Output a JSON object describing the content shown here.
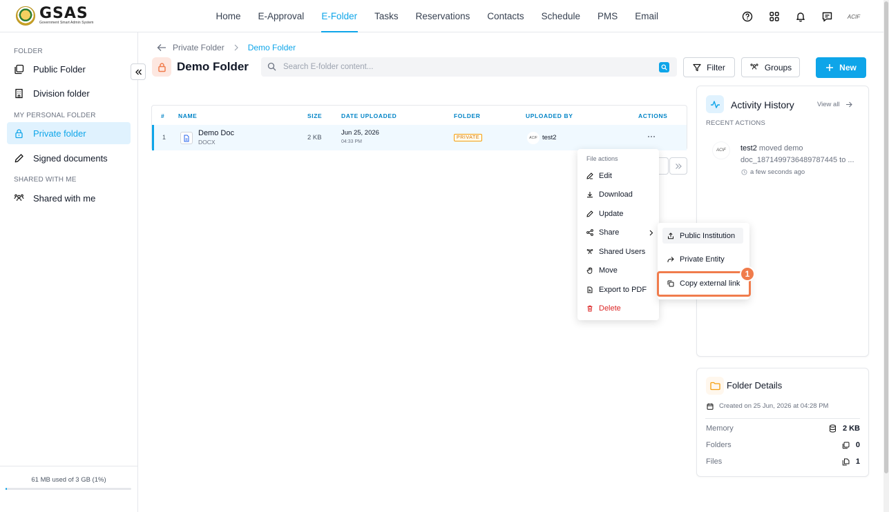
{
  "app": {
    "logo_title": "GSAS",
    "logo_subtitle": "Government Smart Admin System"
  },
  "nav": {
    "items": [
      "Home",
      "E-Approval",
      "E-Folder",
      "Tasks",
      "Reservations",
      "Contacts",
      "Schedule",
      "PMS",
      "Email"
    ],
    "active": "E-Folder"
  },
  "top_icons": [
    "help-icon",
    "apps-grid-icon",
    "bell-icon",
    "chat-icon"
  ],
  "user_avatar": "ACIF",
  "sidebar": {
    "section_folder": "FOLDER",
    "public_folder": "Public Folder",
    "division_folder": "Division folder",
    "section_personal": "MY PERSONAL FOLDER",
    "private_folder": "Private folder",
    "signed_documents": "Signed documents",
    "section_shared": "SHARED WITH ME",
    "shared_with_me": "Shared with me",
    "storage_text": "61 MB used of 3 GB (1%)",
    "storage_percent": 1
  },
  "breadcrumb": {
    "parent": "Private Folder",
    "current": "Demo Folder"
  },
  "header": {
    "title": "Demo Folder",
    "search_placeholder": "Search E-folder content...",
    "filter_label": "Filter",
    "groups_label": "Groups",
    "new_label": "New"
  },
  "table": {
    "columns": [
      "#",
      "NAME",
      "SIZE",
      "DATE UPLOADED",
      "FOLDER",
      "UPLOADED BY",
      "ACTIONS"
    ],
    "rows": [
      {
        "index": "1",
        "name": "Demo Doc",
        "type": "DOCX",
        "size": "2 KB",
        "date": "Jun 25, 2026",
        "time": "04:33 PM",
        "folder": "PRIVATE",
        "uploaded_by": "test2",
        "avatar": "ACIF"
      }
    ]
  },
  "menu": {
    "title": "File actions",
    "edit": "Edit",
    "download": "Download",
    "update": "Update",
    "share": "Share",
    "shared_users": "Shared Users",
    "move": "Move",
    "export_pdf": "Export to PDF",
    "delete": "Delete"
  },
  "submenu": {
    "public_institution": "Public Institution",
    "private_entity": "Private Entity",
    "copy_link": "Copy external link"
  },
  "step_marker": "1",
  "activity": {
    "title": "Activity History",
    "view_all": "View all",
    "recent_label": "RECENT ACTIONS",
    "avatar": "ACIF",
    "user": "test2",
    "text": " moved demo doc_1871499736489787445 to ...",
    "time": "a few seconds ago"
  },
  "details": {
    "title": "Folder Details",
    "created": "Created on 25 Jun, 2026 at 04:28 PM",
    "memory_label": "Memory",
    "memory_value": "2 KB",
    "folders_label": "Folders",
    "folders_value": "0",
    "files_label": "Files",
    "files_value": "1"
  },
  "colors": {
    "accent": "#0ea5e9",
    "highlight": "#f07c4c",
    "danger": "#dc2626",
    "private_badge": "#d97706"
  }
}
